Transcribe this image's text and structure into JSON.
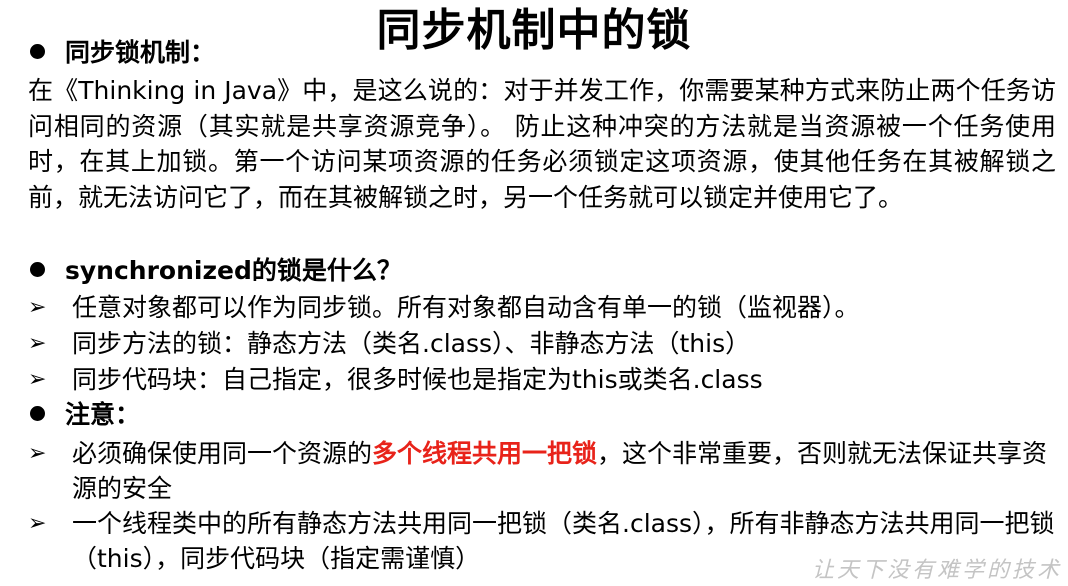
{
  "title": "同步机制中的锁",
  "section1": {
    "heading": "同步锁机制：",
    "paragraph": "在《Thinking in Java》中，是这么说的：对于并发工作，你需要某种方式来防止两个任务访问相同的资源（其实就是共享资源竞争）。 防止这种冲突的方法就是当资源被一个任务使用时，在其上加锁。第一个访问某项资源的任务必须锁定这项资源，使其他任务在其被解锁之前，就无法访问它了，而在其被解锁之时，另一个任务就可以锁定并使用它了。"
  },
  "section2": {
    "heading": "synchronized的锁是什么？",
    "items": [
      "任意对象都可以作为同步锁。所有对象都自动含有单一的锁（监视器）。",
      "同步方法的锁：静态方法（类名.class）、非静态方法（this）",
      "同步代码块：自己指定，很多时候也是指定为this或类名.class"
    ]
  },
  "section3": {
    "heading": "注意：",
    "item1_before": "必须确保使用同一个资源的",
    "item1_highlight": "多个线程共用一把锁",
    "item1_after": "，这个非常重要，否则就无法保证共享资源的安全",
    "item2": "一个线程类中的所有静态方法共用同一把锁（类名.class），所有非静态方法共用同一把锁（this），同步代码块（指定需谨慎）"
  },
  "watermark": "让天下没有难学的技术",
  "colors": {
    "highlight": "#e8231a",
    "watermark": "#c4c4c4"
  }
}
